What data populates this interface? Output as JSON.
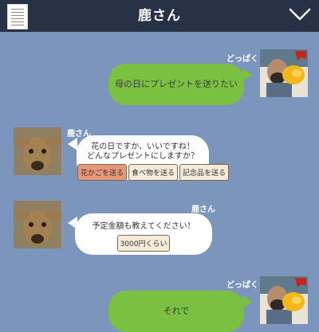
{
  "header": {
    "title": "鹿さん"
  },
  "messages": [
    {
      "sender": "どっぱく",
      "text": "母の日にプレゼントを送りたい"
    },
    {
      "sender": "鹿さん",
      "lines": [
        "花の日ですか、いいですね！",
        "どんなプレゼントにしますか？"
      ],
      "quick_replies": [
        "花かごを送る",
        "食べ物を送る",
        "記念品を送る"
      ]
    },
    {
      "sender": "鹿さん",
      "lines": [
        "予定金額も教えてください！"
      ],
      "quick_replies": [
        "3000円くらい"
      ]
    },
    {
      "sender": "どっぱく",
      "text": "それで"
    }
  ],
  "colors": {
    "header_bg": "#273247",
    "chat_bg": "#7c95bd",
    "user_bubble": "#7ac142",
    "bot_bubble": "#ffffff",
    "selected_reply": "#e8977b"
  }
}
